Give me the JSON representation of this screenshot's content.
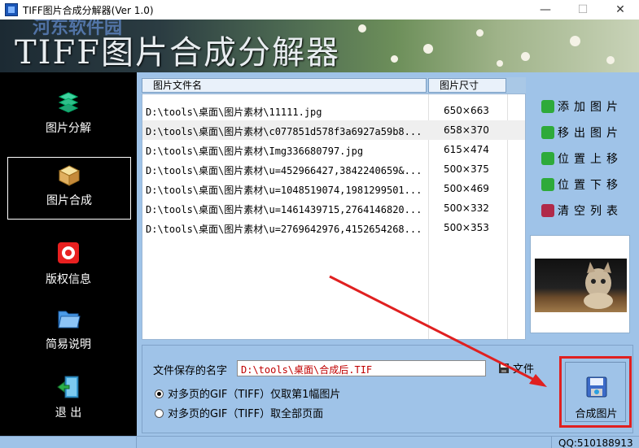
{
  "window": {
    "title": "TIFF图片合成分解器(Ver 1.0)",
    "controls": {
      "minimize": "—",
      "maximize": "☐",
      "close": "✕"
    }
  },
  "banner": {
    "title": "TIFF图片合成分解器",
    "watermark": "河东软件园"
  },
  "sidebar": {
    "items": [
      {
        "label": "图片分解",
        "icon": "layers-icon",
        "selected": false
      },
      {
        "label": "图片合成",
        "icon": "cube-icon",
        "selected": true
      },
      {
        "label": "版权信息",
        "icon": "copyright-icon",
        "selected": false
      },
      {
        "label": "简易说明",
        "icon": "folder-icon",
        "selected": false
      },
      {
        "label": "退 出",
        "icon": "exit-door-icon",
        "selected": false
      }
    ]
  },
  "list": {
    "columns": [
      "图片文件名",
      "图片尺寸"
    ],
    "rows": [
      {
        "path": "D:\\tools\\桌面\\图片素材\\11111.jpg",
        "size": "650×663"
      },
      {
        "path": "D:\\tools\\桌面\\图片素材\\c077851d578f3a6927a59b8...",
        "size": "658×370"
      },
      {
        "path": "D:\\tools\\桌面\\图片素材\\Img336680797.jpg",
        "size": "615×474"
      },
      {
        "path": "D:\\tools\\桌面\\图片素材\\u=452966427,3842240659&...",
        "size": "500×375"
      },
      {
        "path": "D:\\tools\\桌面\\图片素材\\u=1048519074,1981299501...",
        "size": "500×469"
      },
      {
        "path": "D:\\tools\\桌面\\图片素材\\u=1461439715,2764146820...",
        "size": "500×332"
      },
      {
        "path": "D:\\tools\\桌面\\图片素材\\u=2769642976,4152654268...",
        "size": "500×353"
      }
    ]
  },
  "actions": {
    "add": "添加图片",
    "remove": "移出图片",
    "move_up": "位置上移",
    "move_down": "位置下移",
    "clear": "清空列表"
  },
  "output": {
    "label": "文件保存的名字",
    "path": "D:\\tools\\桌面\\合成后.TIF",
    "file_button": "文件",
    "radio_first": "对多页的GIF（TIFF）仅取第1幅图片",
    "radio_all": "对多页的GIF（TIFF）取全部页面",
    "selected_option": "first",
    "merge_button": "合成图片"
  },
  "status": {
    "qq": "QQ:510188913"
  },
  "colors": {
    "accent_red": "#e02020",
    "path_red": "#c00000",
    "panel_blue": "#9fc3e8"
  }
}
